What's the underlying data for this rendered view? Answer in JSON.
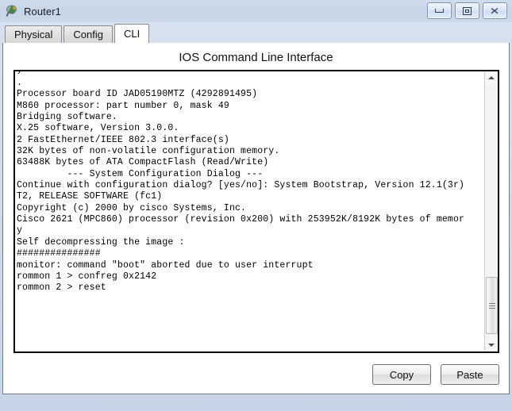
{
  "window": {
    "title": "Router1",
    "icon": "router-icon",
    "controls": {
      "minimize": "minimize-button",
      "maximize": "maximize-button",
      "close": "close-button",
      "close_glyph": "✕"
    }
  },
  "tabs": [
    {
      "label": "Physical",
      "active": false
    },
    {
      "label": "Config",
      "active": false
    },
    {
      "label": "CLI",
      "active": true
    }
  ],
  "panel": {
    "title": "IOS Command Line Interface"
  },
  "terminal": {
    "lines": [
      "y",
      ".",
      "Processor board ID JAD05190MTZ (4292891495)",
      "M860 processor: part number 0, mask 49",
      "Bridging software.",
      "X.25 software, Version 3.0.0.",
      "2 FastEthernet/IEEE 802.3 interface(s)",
      "32K bytes of non-volatile configuration memory.",
      "63488K bytes of ATA CompactFlash (Read/Write)",
      "",
      "",
      "         --- System Configuration Dialog ---",
      "",
      "Continue with configuration dialog? [yes/no]: System Bootstrap, Version 12.1(3r)",
      "T2, RELEASE SOFTWARE (fc1)",
      "Copyright (c) 2000 by cisco Systems, Inc.",
      "Cisco 2621 (MPC860) processor (revision 0x200) with 253952K/8192K bytes of memor",
      "y",
      "",
      "Self decompressing the image :",
      "###############",
      "monitor: command \"boot\" aborted due to user interrupt",
      "rommon 1 > confreg 0x2142",
      "rommon 2 > reset"
    ]
  },
  "scrollbar": {
    "up_arrow": "scroll-up-arrow",
    "down_arrow": "scroll-down-arrow",
    "thumb": "scroll-thumb"
  },
  "buttons": {
    "copy": "Copy",
    "paste": "Paste"
  },
  "colors": {
    "titlebar": "#c9d7e8",
    "panel": "#ffffff",
    "terminal_text": "#000000",
    "tab_active": "#ffffff"
  }
}
